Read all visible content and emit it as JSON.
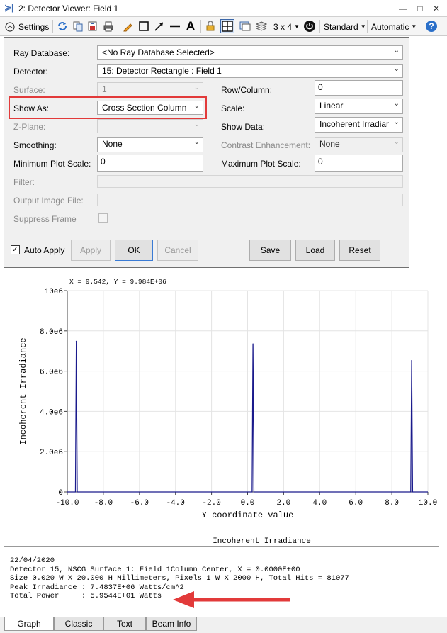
{
  "window": {
    "title": "2: Detector Viewer: Field 1",
    "minimize": "—",
    "restore": "□",
    "close": "✕"
  },
  "toolbar": {
    "settings_label": "Settings",
    "layout_label": "3 x 4",
    "standard_label": "Standard",
    "automatic_label": "Automatic",
    "help_glyph": "?"
  },
  "settings": {
    "ray_database_label": "Ray Database:",
    "ray_database_value": "<No Ray Database Selected>",
    "detector_label": "Detector:",
    "detector_value": "15: Detector Rectangle : Field 1",
    "surface_label": "Surface:",
    "surface_value": "1",
    "row_column_label": "Row/Column:",
    "row_column_value": "0",
    "show_as_label": "Show As:",
    "show_as_value": "Cross Section Column",
    "scale_label": "Scale:",
    "scale_value": "Linear",
    "z_plane_label": "Z-Plane:",
    "z_plane_value": "",
    "show_data_label": "Show Data:",
    "show_data_value": "Incoherent Irradiar",
    "smoothing_label": "Smoothing:",
    "smoothing_value": "None",
    "contrast_label": "Contrast Enhancement:",
    "contrast_value": "None",
    "min_plot_scale_label": "Minimum Plot Scale:",
    "min_plot_scale_value": "0",
    "max_plot_scale_label": "Maximum Plot Scale:",
    "max_plot_scale_value": "0",
    "filter_label": "Filter:",
    "output_file_label": "Output Image File:",
    "suppress_frame_label": "Suppress Frame",
    "auto_apply_label": "Auto Apply",
    "auto_apply_checked": "✓",
    "apply_label": "Apply",
    "ok_label": "OK",
    "cancel_label": "Cancel",
    "save_label": "Save",
    "load_label": "Load",
    "reset_label": "Reset"
  },
  "plot": {
    "cursor_readout": "X = 9.542, Y = 9.984E+06",
    "caption": "Incoherent Irradiance"
  },
  "chart_data": {
    "type": "line",
    "title": "",
    "xlabel": "Y coordinate value",
    "ylabel": "Incoherent Irradiance",
    "xlim": [
      -10.0,
      10.0
    ],
    "ylim": [
      0,
      10000000
    ],
    "x_ticks": [
      "-10.0",
      "-8.0",
      "-6.0",
      "-4.0",
      "-2.0",
      "0.0",
      "2.0",
      "4.0",
      "6.0",
      "8.0",
      "10.0"
    ],
    "y_ticks": [
      "0",
      "2.0e6",
      "4.0e6",
      "6.0e6",
      "8.0e6",
      "10e6"
    ],
    "grid": true,
    "series_color": "#1a1a8c",
    "series": [
      {
        "x": [
          -10.0,
          -9.6,
          -9.55,
          -9.5,
          -9.45,
          -9.4,
          0.2,
          0.25,
          0.3,
          0.35,
          0.4,
          9.0,
          9.05,
          9.1,
          9.15,
          9.2,
          10.0
        ],
        "values": [
          0,
          0,
          0,
          7480000,
          0,
          0,
          0,
          0,
          7350000,
          0,
          0,
          0,
          0,
          6520000,
          0,
          0,
          0
        ]
      }
    ]
  },
  "report": {
    "lines": [
      "22/04/2020",
      "Detector 15, NSCG Surface 1: Field 1Column Center, X = 0.0000E+00",
      "Size 0.020 W X 20.000 H Millimeters, Pixels 1 W X 2000 H, Total Hits = 81077",
      "Peak Irradiance : 7.4837E+06 Watts/cm^2",
      "Total Power     : 5.9544E+01 Watts"
    ]
  },
  "tabs": [
    {
      "label": "Graph"
    },
    {
      "label": "Classic"
    },
    {
      "label": "Text"
    },
    {
      "label": "Beam Info"
    }
  ],
  "colors": {
    "highlight": "#e23a3a",
    "accent": "#3d6bb3"
  }
}
